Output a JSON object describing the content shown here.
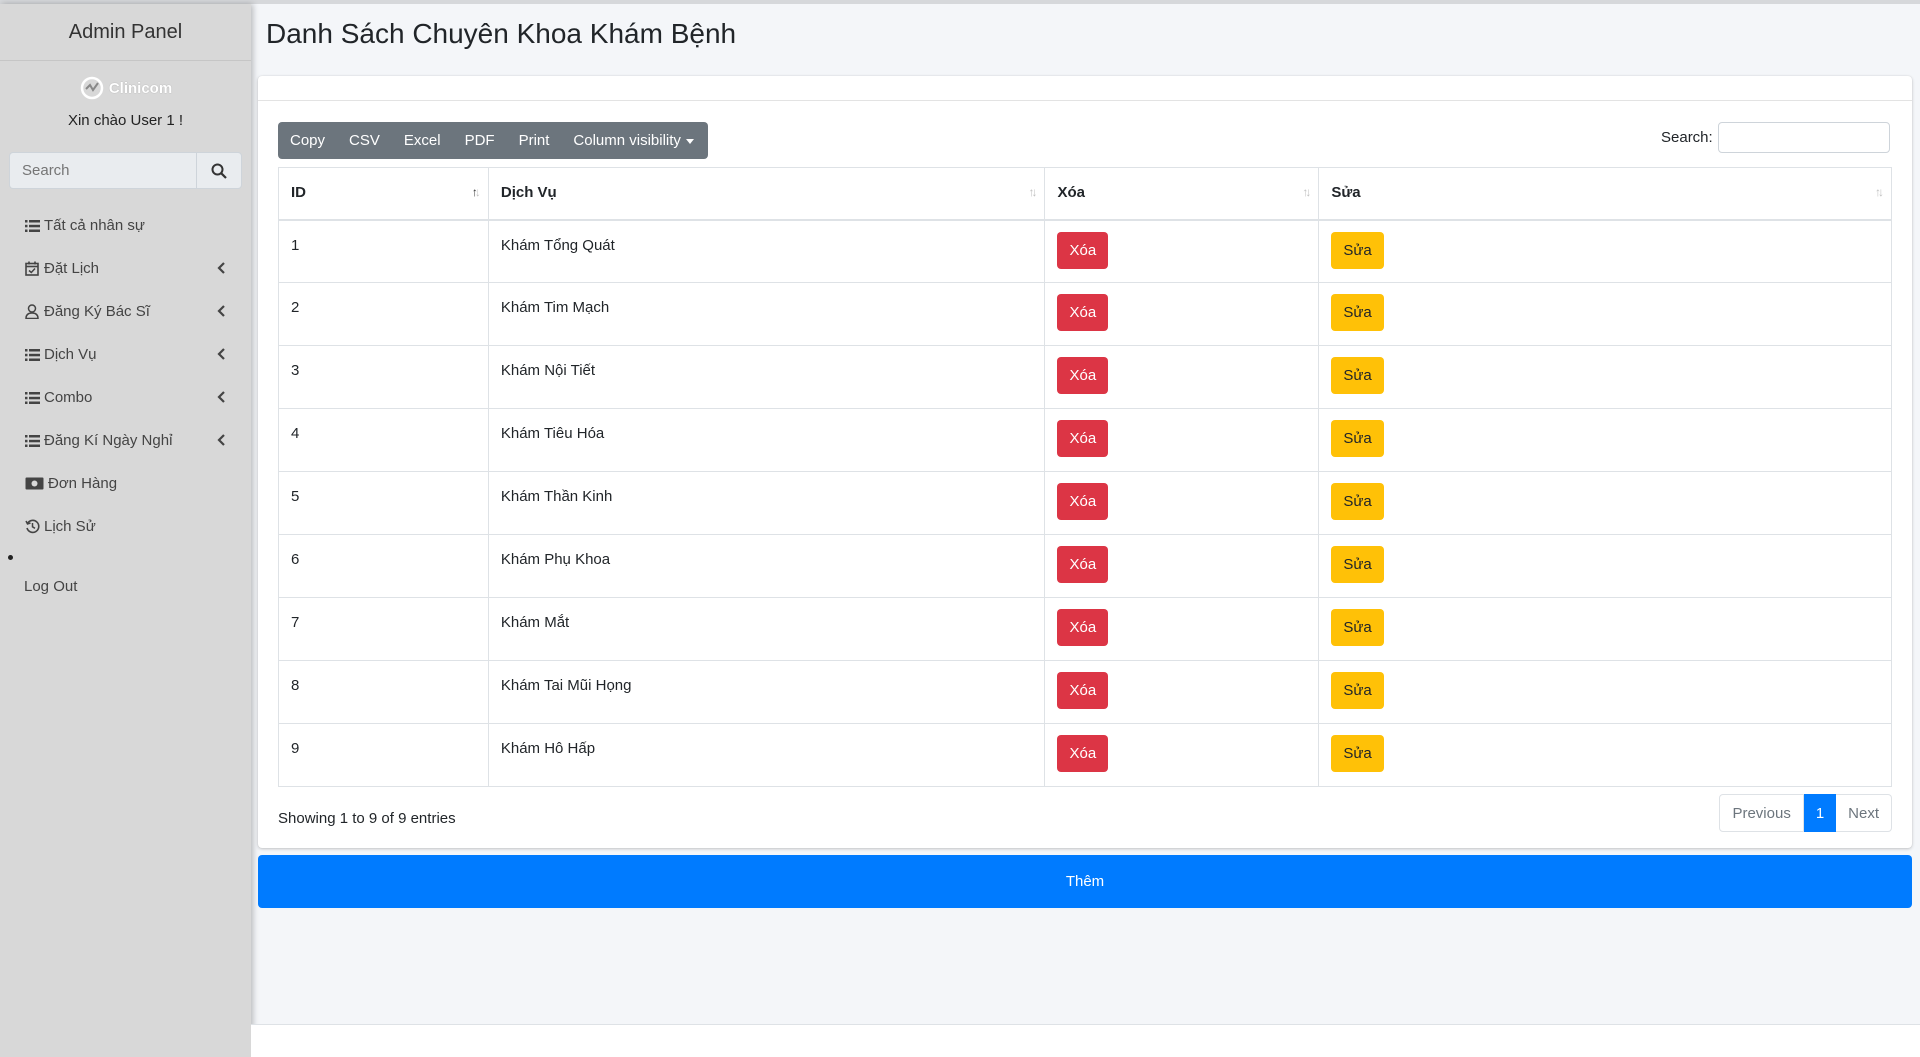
{
  "sidebar": {
    "brand": "Admin Panel",
    "logo_text": "Clinicom",
    "greeting": "Xin chào User 1 !",
    "search_placeholder": "Search",
    "items": [
      {
        "label": "Tất cả nhân sự",
        "icon": "list-icon",
        "has_chevron": false
      },
      {
        "label": "Đặt Lịch",
        "icon": "calendar-check-icon",
        "has_chevron": true
      },
      {
        "label": "Đăng Ký Bác Sĩ",
        "icon": "user-icon",
        "has_chevron": true
      },
      {
        "label": "Dịch Vụ",
        "icon": "list-icon",
        "has_chevron": true
      },
      {
        "label": "Combo",
        "icon": "list-icon",
        "has_chevron": true
      },
      {
        "label": "Đăng Kí Ngày Nghỉ",
        "icon": "list-icon",
        "has_chevron": true
      },
      {
        "label": "Đơn Hàng",
        "icon": "money-bill-icon",
        "has_chevron": false
      },
      {
        "label": "Lịch Sử",
        "icon": "history-icon",
        "has_chevron": false
      }
    ],
    "logout": "Log Out"
  },
  "main": {
    "title": "Danh Sách Chuyên Khoa Khám Bệnh",
    "toolbar": {
      "copy": "Copy",
      "csv": "CSV",
      "excel": "Excel",
      "pdf": "PDF",
      "print": "Print",
      "column_visibility": "Column visibility"
    },
    "search_label": "Search:",
    "table": {
      "headers": [
        "ID",
        "Dịch Vụ",
        "Xóa",
        "Sửa"
      ],
      "delete_label": "Xóa",
      "edit_label": "Sửa",
      "rows": [
        {
          "id": "1",
          "name": "Khám Tổng Quát"
        },
        {
          "id": "2",
          "name": "Khám Tim Mạch"
        },
        {
          "id": "3",
          "name": "Khám Nội Tiết"
        },
        {
          "id": "4",
          "name": "Khám Tiêu Hóa"
        },
        {
          "id": "5",
          "name": "Khám Thần Kinh"
        },
        {
          "id": "6",
          "name": "Khám Phụ Khoa"
        },
        {
          "id": "7",
          "name": "Khám Mắt"
        },
        {
          "id": "8",
          "name": "Khám Tai Mũi Họng"
        },
        {
          "id": "9",
          "name": "Khám Hô Hấp"
        }
      ]
    },
    "info": "Showing 1 to 9 of 9 entries",
    "pagination": {
      "previous": "Previous",
      "current": "1",
      "next": "Next"
    },
    "add_button": "Thêm"
  },
  "colors": {
    "primary": "#007bff",
    "danger": "#dc3545",
    "warning": "#ffc107",
    "secondary": "#6c757d",
    "sidebar_bg": "#d8d8d8"
  }
}
